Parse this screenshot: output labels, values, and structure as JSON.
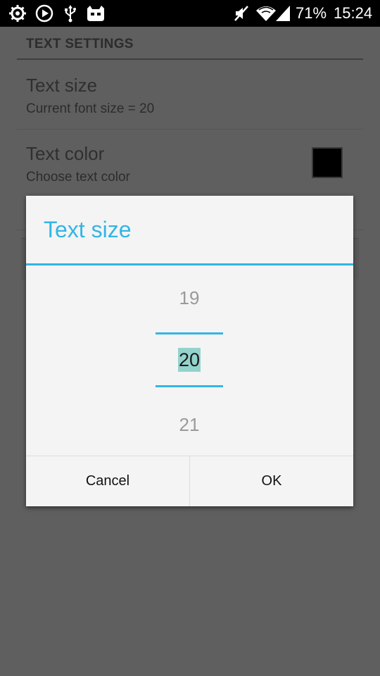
{
  "status_bar": {
    "battery": "71%",
    "time": "15:24",
    "icons": [
      "sync-icon",
      "play-icon",
      "usb-icon",
      "cyanogen-icon",
      "mute-icon",
      "wifi-icon",
      "signal-icon"
    ]
  },
  "settings": {
    "section_header": "TEXT SETTINGS",
    "items": [
      {
        "title": "Text size",
        "summary": "Current font size = 20"
      },
      {
        "title": "Text color",
        "summary": "Choose text color",
        "swatch_color": "#000000"
      }
    ]
  },
  "dialog": {
    "title": "Text size",
    "picker": {
      "previous": "19",
      "current": "20",
      "next": "21"
    },
    "cancel_label": "Cancel",
    "ok_label": "OK",
    "accent_color": "#33b5e5"
  }
}
